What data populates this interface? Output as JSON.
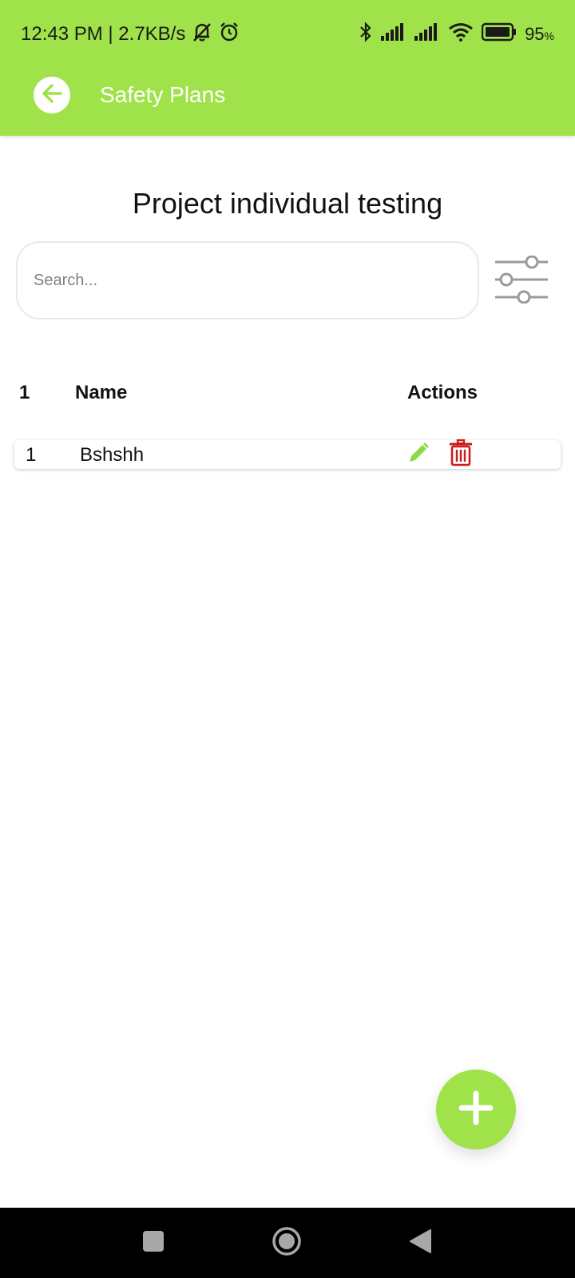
{
  "status_bar": {
    "time_speed": "12:43 PM | 2.7KB/s",
    "battery_percent": "95",
    "battery_unit": "%",
    "icons": [
      "mute-bell-icon",
      "alarm-icon",
      "bluetooth-icon",
      "signal-icon",
      "signal-icon",
      "wifi-icon",
      "battery-icon"
    ]
  },
  "app_bar": {
    "title": "Safety Plans",
    "back_icon": "arrow-left-icon"
  },
  "page": {
    "title": "Project individual testing"
  },
  "search": {
    "placeholder": "Search...",
    "value": ""
  },
  "table": {
    "headers": {
      "index": "1",
      "name": "Name",
      "actions": "Actions"
    },
    "rows": [
      {
        "index": "1",
        "name": "Bshshh"
      }
    ]
  },
  "colors": {
    "primary": "#9fe249",
    "edit": "#8bd94a",
    "delete": "#d01a1a"
  },
  "fab": {
    "icon": "plus-icon"
  },
  "nav_bar": {
    "icons": [
      "recent-apps-icon",
      "home-icon",
      "back-icon"
    ]
  }
}
